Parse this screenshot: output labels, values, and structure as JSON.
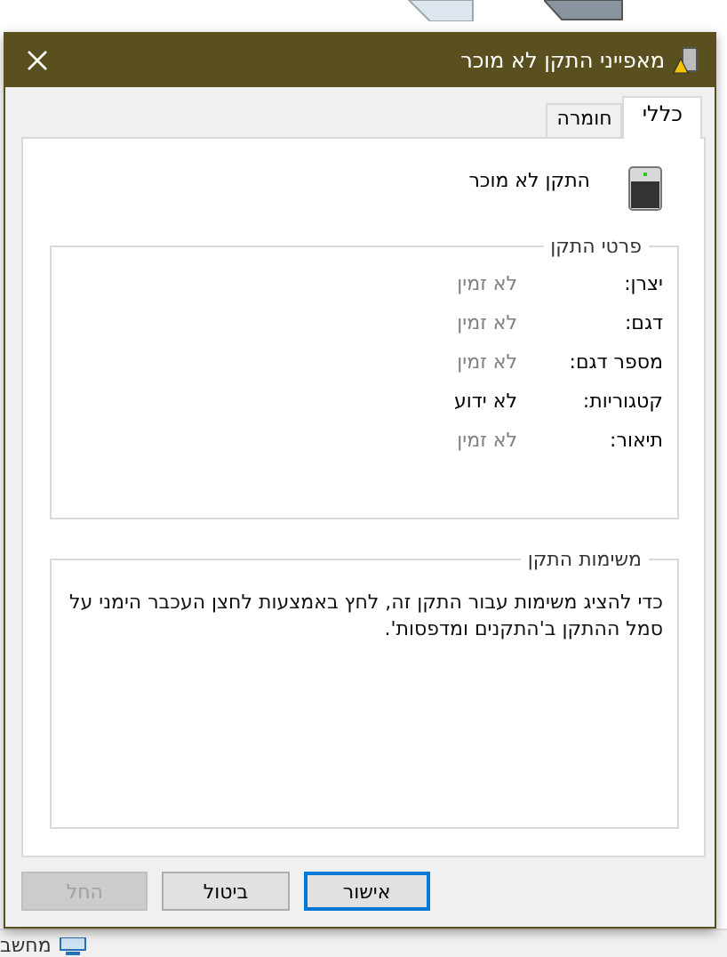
{
  "window": {
    "title": "מאפייני התקן לא מוכר"
  },
  "tabs": [
    {
      "label": "כללי",
      "selected": true
    },
    {
      "label": "חומרה",
      "selected": false
    }
  ],
  "device_name": "התקן לא מוכר",
  "details": {
    "title": "פרטי התקן",
    "fields": [
      {
        "label": "יצרן:",
        "value": "לא זמין",
        "dimmed": true
      },
      {
        "label": "דגם:",
        "value": "לא זמין",
        "dimmed": true
      },
      {
        "label": "מספר דגם:",
        "value": "לא זמין",
        "dimmed": true
      },
      {
        "label": "קטגוריות:",
        "value": "לא ידוע",
        "dimmed": false
      },
      {
        "label": "תיאור:",
        "value": "לא זמין",
        "dimmed": true
      }
    ]
  },
  "tasks": {
    "title": "משימות התקן",
    "text": "כדי להציג משימות עבור התקן זה, לחץ באמצעות לחצן העכבר הימני על סמל ההתקן ב'התקנים ומדפסות'."
  },
  "buttons": [
    {
      "label": "אישור",
      "default": true,
      "disabled": false
    },
    {
      "label": "ביטול",
      "default": false,
      "disabled": false
    },
    {
      "label": "החל",
      "default": false,
      "disabled": true
    }
  ],
  "background": {
    "taskbar_label": "מחשב"
  }
}
